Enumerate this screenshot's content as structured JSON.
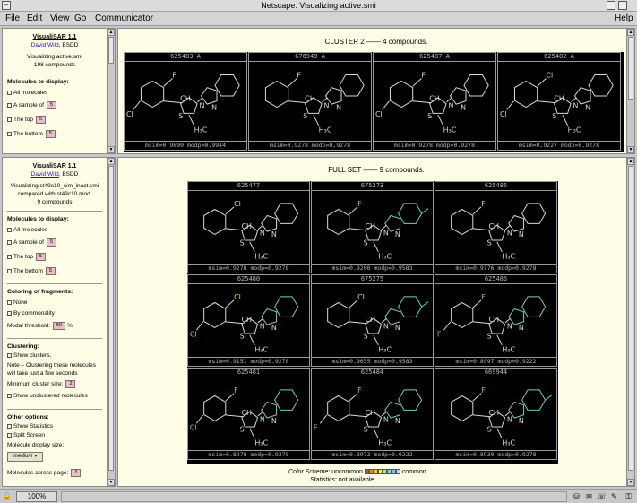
{
  "window": {
    "title": "Netscape: Visualizing active.smi"
  },
  "menus": [
    "File",
    "Edit",
    "View",
    "Go",
    "Communicator"
  ],
  "help": "Help",
  "top_sidebar": {
    "app_title": "VisualiSAR 1.1",
    "author": "David Wild",
    "org": "BSDD",
    "caption": "Visualizing active.smi",
    "count": "198 compounds",
    "molecules_heading": "Molecules to display:",
    "opt_all": "All molecules",
    "opt_sample": "A sample of",
    "opt_top": "The top",
    "opt_bottom": "The bottom",
    "n_sample": "5",
    "n_top": "5",
    "n_bottom": "5"
  },
  "bottom_sidebar": {
    "app_title": "VisualiSAR 1.1",
    "author": "David Wild",
    "org": "BSDD",
    "caption1": "Visualizing st49c10_sim_inact.smi",
    "caption2": "compared with st49c10.mod.",
    "count": "9 compounds",
    "molecules_heading": "Molecules to display:",
    "opt_all": "All molecules",
    "opt_sample": "A sample of",
    "opt_top": "The top",
    "opt_bottom": "The bottom",
    "n_sample": "5",
    "n_top": "5",
    "n_bottom": "5",
    "coloring_heading": "Coloring of fragments:",
    "coloring_none": "None",
    "coloring_common": "By commonality",
    "modal_label": "Modal threshold:",
    "modal_value": "50",
    "modal_unit": "%",
    "clustering_heading": "Clustering:",
    "show_clusters": "Show clusters.",
    "cluster_note": "Note – Clustering these molecules will take just a few seconds",
    "min_cluster_label": "Minimum cluster size:",
    "min_cluster_value": "2",
    "show_unclustered": "Show unclustered molecules",
    "other_heading": "Other options:",
    "show_statistics": "Show Statistics",
    "split_screen": "Split Screen",
    "display_size_label": "Molecule display size:",
    "display_size_value": "medium",
    "across_label": "Molecules across page:",
    "across_value": "3"
  },
  "cluster": {
    "heading": "CLUSTER 2 —— 4 compounds.",
    "cells": [
      {
        "id": "625483 A",
        "scores": "msim=0.9890 modp=0.9944"
      },
      {
        "id": "676949 A",
        "scores": "msim=0.9278 modp=0.9278"
      },
      {
        "id": "625487 A",
        "scores": "msim=0.9278 modp=0.9278"
      },
      {
        "id": "625482 A",
        "scores": "msim=0.9227 modp=0.9278"
      }
    ]
  },
  "fullset": {
    "heading": "FULL SET —— 9 compounds.",
    "cells": [
      {
        "id": "625477",
        "scores": "msim=0.9278 modp=0.9278"
      },
      {
        "id": "675273",
        "scores": "msim=0.9200 modp=0.9583"
      },
      {
        "id": "625485",
        "scores": "msim=0.9176 modp=0.9278"
      },
      {
        "id": "625480",
        "scores": "msim=0.9151 modp=0.9278"
      },
      {
        "id": "675275",
        "scores": "msim=0.9055 modp=0.9583"
      },
      {
        "id": "625486",
        "scores": "msim=0.8997 modp=0.9222"
      },
      {
        "id": "625481",
        "scores": "msim=0.8978 modp=0.9278"
      },
      {
        "id": "625484",
        "scores": "msim=0.8973 modp=0.9222"
      },
      {
        "id": "669944",
        "scores": "msim=0.8930 modp=0.9278"
      }
    ],
    "legend_prefix": "Color Scheme",
    "legend_uncommon": "uncommon",
    "legend_common": "common",
    "legend_colors": [
      "#e84830",
      "#f08030",
      "#f8c040",
      "#f8f060",
      "#a8f080",
      "#60e8e0",
      "#80c0f8",
      "#c0d8f8"
    ],
    "stats_prefix": "Statistics",
    "stats_text": "not available."
  },
  "atoms": {
    "F": "F",
    "Cl": "Cl",
    "CH": "CH",
    "S": "S",
    "N": "N",
    "H3C": "H₃C"
  },
  "colors": {
    "bond": "#d8d8d8",
    "cl_yellow": "#e0e040",
    "cl_green": "#80e060",
    "f_green": "#60e060",
    "ring_teal": "#70d0c0"
  },
  "status": {
    "zoom": "100%"
  }
}
